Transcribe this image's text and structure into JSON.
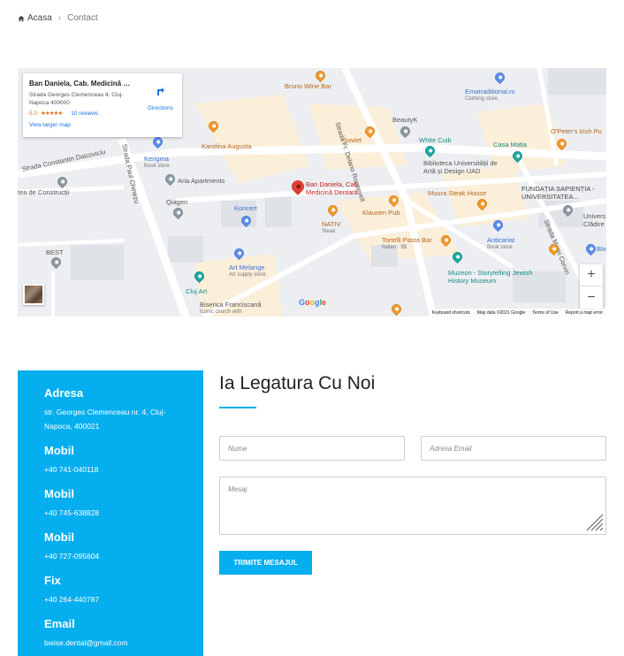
{
  "breadcrumb": {
    "home": "Acasa",
    "separator": "›",
    "current": "Contact"
  },
  "map": {
    "card": {
      "title": "Ban Daniela, Cab. Medicină D...",
      "address": "Strada Georges Clemenceau 4, Cluj-Napoca 400000",
      "rating": "5.0",
      "stars": "★★★★★",
      "reviews": "10 reviews",
      "view_larger": "View larger map",
      "directions": "Directions"
    },
    "labels": {
      "bruno": "Bruno Wine Bar",
      "strada_ferdinand": "Strada Fr. Delano Roosevelt",
      "ematraditional": "Ematraditional.ro",
      "ematraditional_sub": "Clothing store",
      "karolina": "Karolina Augusta",
      "soviet": "Soviet",
      "beautyk": "BeautyK",
      "white_cuib": "White Cuib",
      "casa_matia": "Casa Matia",
      "opeters": "O'Peter's Irish Pu",
      "strada_daicoviciu": "Strada Constantin Daicoviciu",
      "kerigma": "Kerigma",
      "kerigma_sub": "Book store",
      "biblioteca": "Biblioteca Universității de Artă și Design UAD",
      "aria": "Aria Apartments",
      "strada_chinezu": "Strada Paul Chinezu",
      "constructii": "tea de Construcții",
      "ban_daniela": "Ban Daniela, Cab. Medicină Dentară",
      "muura": "Muura Steak House",
      "fundatia": "FUNDAȚIA SAPIENȚIA - UNIVERSITATEA...",
      "qiagen": "Qiagen",
      "koncert": "Koncert",
      "klausen": "Klausen Pub",
      "univ": "Univers Clădire",
      "nativ": "NATIV",
      "nativ_sub": "Steak",
      "tortelli": "Tortelli Pasta Bar",
      "tortelli_sub": "Italian · $$",
      "anticariat": "Anticariat",
      "anticariat_sub": "Book store",
      "strada_matei": "Strada Matei Corvin",
      "best": "BEST",
      "blo": "Blo",
      "art_melange": "Art Melange",
      "art_melange_sub": "Art supply store",
      "muzeon": "Muzeon - Storytelling Jewish History Museum",
      "cluj_art": "Cluj Art",
      "biserica": "Biserica Franciscană",
      "biserica_sub": "Iconic church with"
    },
    "zoom_in": "+",
    "zoom_out": "−",
    "attribution": {
      "shortcuts": "Keyboard shortcuts",
      "data": "Map data ©2021 Google",
      "terms": "Terms of Use",
      "report": "Report a map error"
    }
  },
  "contact": {
    "items": [
      {
        "label": "Adresa",
        "value": "str. Georges Clemenceau nr. 4, Cluj-Napoca, 400021"
      },
      {
        "label": "Mobil",
        "value": "+40 741-040118"
      },
      {
        "label": "Mobil",
        "value": "+40 745-638828"
      },
      {
        "label": "Mobil",
        "value": "+40 727-095604"
      },
      {
        "label": "Fix",
        "value": "+40 264-440787"
      },
      {
        "label": "Email",
        "value": "bwise.dental@gmail.com"
      }
    ]
  },
  "form": {
    "title": "Ia Legatura Cu Noi",
    "name_placeholder": "Nume",
    "email_placeholder": "Adresa Email",
    "message_placeholder": "Mesaj",
    "submit_label": "TRIMITE MESAJUL"
  },
  "colors": {
    "accent": "#05aeef"
  }
}
